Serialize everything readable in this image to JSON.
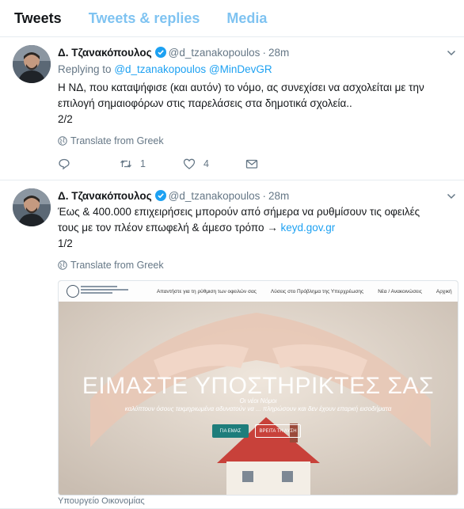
{
  "tabs": [
    "Tweets",
    "Tweets & replies",
    "Media"
  ],
  "colors": {
    "accent": "#1da1f2",
    "secondary": "#657786",
    "tab_inactive": "#7fc3f1"
  },
  "tweets": [
    {
      "name": "Δ. Τζανακόπουλος",
      "handle": "@d_tzanakopoulos",
      "time": "28m",
      "replying_prefix": "Replying to",
      "replying_to": [
        "@d_tzanakopoulos",
        "@MinDevGR"
      ],
      "text_line1": "Η ΝΔ, που καταψήφισε (και αυτόν) το νόμο, ας συνεχίσει να ασχολείται με την",
      "text_line2": "επιλογή σημαιοφόρων στις παρελάσεις στα δημοτικά σχολεία..",
      "text_line3": "2/2",
      "translate": "Translate from Greek",
      "retweets": "1",
      "likes": "4"
    },
    {
      "name": "Δ. Τζανακόπουλος",
      "handle": "@d_tzanakopoulos",
      "time": "28m",
      "text_line1": "Έως & 400.000 επιχειρήσεις μπορούν από σήμερα να ρυθμίσουν τις οφειλές",
      "text_line2_pre": "τους με τον πλέον επωφελή & άμεσο τρόπο → ",
      "text_link": "keyd.gov.gr",
      "text_line3": "1/2",
      "translate": "Translate from Greek",
      "card": {
        "nav": [
          "Απαντήστε για τη ρύθμιση των οφειλών σας",
          "Λύσεις στο Πρόβλημα της Υπερχρέωσης",
          "Νέα / Ανακοινώσεις",
          "Αρχική"
        ],
        "hero_title": "ΕΙΜΑΣΤΕ ΥΠΟΣΤΗΡΙΚΤΕΣ ΣΑΣ",
        "hero_sub": "Οι νέοι Νόμοι",
        "hero_sub2": "καλύπτουν όσους τεκμηριωμένα αδυνατούν να ... πληρώσουν και δεν έχουν επαρκή εισοδήματα",
        "btn_us": "ΓΙΑ ΕΜΑΣ",
        "btn_solution": "ΒΡΕΙΤΑ ΤΗ ΛΥΣΗ"
      },
      "source": "Υπουργείο Οικονομίας"
    }
  ]
}
